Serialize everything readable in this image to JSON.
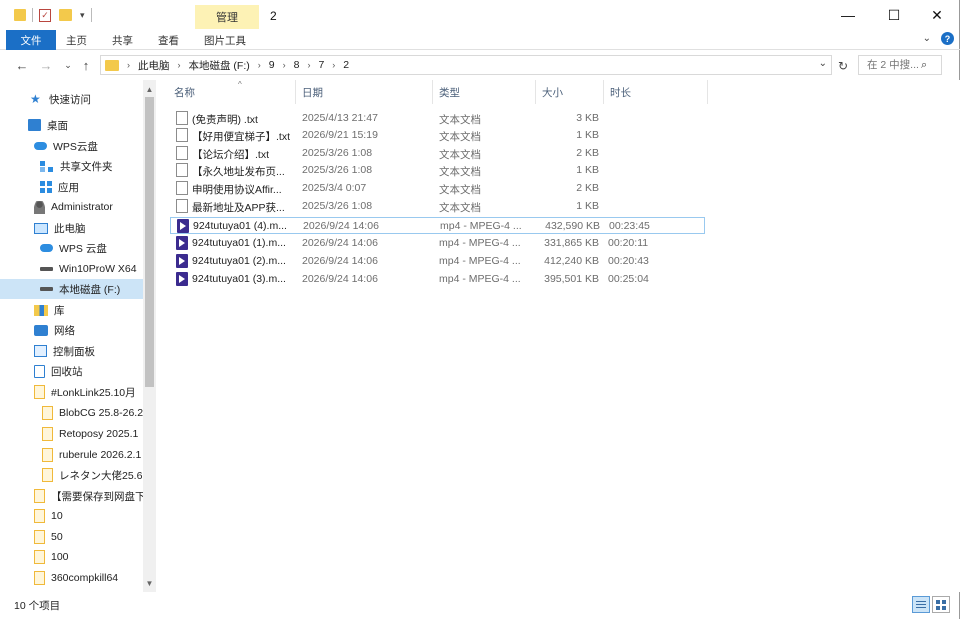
{
  "window": {
    "title": "2",
    "context_tab": "管理",
    "controls": {
      "minimize": "—",
      "maximize": "☐",
      "close": "✕"
    }
  },
  "ribbon": {
    "tabs": [
      "文件",
      "主页",
      "共享",
      "查看",
      "图片工具"
    ],
    "accent_color": "#1b6fc6"
  },
  "address": {
    "crumbs": [
      "此电脑",
      "本地磁盘 (F:)",
      "9",
      "8",
      "7",
      "2"
    ],
    "search_placeholder": "在 2 中搜...",
    "icons": {
      "back": "arrow-left-icon",
      "forward": "arrow-right-icon",
      "recent": "chevron-down-icon",
      "up": "arrow-up-icon",
      "refresh": "refresh-icon",
      "search": "search-icon"
    }
  },
  "sidebar": {
    "items": [
      {
        "label": "快速访问",
        "icon": "star-icon"
      },
      {
        "label": "桌面",
        "icon": "desktop-icon"
      },
      {
        "label": "WPS云盘",
        "icon": "cloud-icon"
      },
      {
        "label": "共享文件夹",
        "icon": "share-icon"
      },
      {
        "label": "应用",
        "icon": "apps-icon"
      },
      {
        "label": "Administrator",
        "icon": "user-icon"
      },
      {
        "label": "此电脑",
        "icon": "computer-icon"
      },
      {
        "label": "WPS 云盘",
        "icon": "cloud-icon"
      },
      {
        "label": "Win10ProW X64",
        "icon": "drive-icon"
      },
      {
        "label": "本地磁盘 (F:)",
        "icon": "drive-icon",
        "selected": true
      },
      {
        "label": "库",
        "icon": "library-icon"
      },
      {
        "label": "网络",
        "icon": "network-icon"
      },
      {
        "label": "控制面板",
        "icon": "control-panel-icon"
      },
      {
        "label": "回收站",
        "icon": "recycle-bin-icon"
      },
      {
        "label": "#LonkLink25.10月",
        "icon": "folder-icon"
      },
      {
        "label": "BlobCG 25.8-26.2",
        "icon": "folder-icon"
      },
      {
        "label": "Retoposy 2025.1",
        "icon": "folder-icon"
      },
      {
        "label": "ruberule 2026.2.1",
        "icon": "folder-icon"
      },
      {
        "label": "レネタン大佬25.6",
        "icon": "folder-icon"
      },
      {
        "label": "【需要保存到网盘下",
        "icon": "folder-icon"
      },
      {
        "label": "10",
        "icon": "folder-icon"
      },
      {
        "label": "50",
        "icon": "folder-icon"
      },
      {
        "label": "100",
        "icon": "folder-icon"
      },
      {
        "label": "360compkill64",
        "icon": "folder-icon"
      }
    ]
  },
  "columns": [
    "名称",
    "日期",
    "类型",
    "大小",
    "时长"
  ],
  "files": [
    {
      "name": "(免责声明) .txt",
      "date": "2025/4/13 21:47",
      "type": "文本文档",
      "size": "3 KB",
      "duration": "",
      "icon": "text-file-icon"
    },
    {
      "name": "【好用便宜梯子】.txt",
      "date": "2026/9/21 15:19",
      "type": "文本文档",
      "size": "1 KB",
      "duration": "",
      "icon": "text-file-icon"
    },
    {
      "name": "【论坛介绍】.txt",
      "date": "2025/3/26 1:08",
      "type": "文本文档",
      "size": "2 KB",
      "duration": "",
      "icon": "text-file-icon"
    },
    {
      "name": "【永久地址发布页...",
      "date": "2025/3/26 1:08",
      "type": "文本文档",
      "size": "1 KB",
      "duration": "",
      "icon": "text-file-icon"
    },
    {
      "name": "申明使用协议Affir...",
      "date": "2025/3/4 0:07",
      "type": "文本文档",
      "size": "2 KB",
      "duration": "",
      "icon": "text-file-icon"
    },
    {
      "name": "最新地址及APP获...",
      "date": "2025/3/26 1:08",
      "type": "文本文档",
      "size": "1 KB",
      "duration": "",
      "icon": "text-file-icon"
    },
    {
      "name": "924tutuya01 (4).m...",
      "date": "2026/9/24 14:06",
      "type": "mp4 - MPEG-4 ...",
      "size": "432,590 KB",
      "duration": "00:23:45",
      "icon": "video-file-icon",
      "focused": true
    },
    {
      "name": "924tutuya01 (1).m...",
      "date": "2026/9/24 14:06",
      "type": "mp4 - MPEG-4 ...",
      "size": "331,865 KB",
      "duration": "00:20:11",
      "icon": "video-file-icon"
    },
    {
      "name": "924tutuya01 (2).m...",
      "date": "2026/9/24 14:06",
      "type": "mp4 - MPEG-4 ...",
      "size": "412,240 KB",
      "duration": "00:20:43",
      "icon": "video-file-icon"
    },
    {
      "name": "924tutuya01 (3).m...",
      "date": "2026/9/24 14:06",
      "type": "mp4 - MPEG-4 ...",
      "size": "395,501 KB",
      "duration": "00:25:04",
      "icon": "video-file-icon"
    }
  ],
  "status": {
    "count": "10 个项目"
  }
}
